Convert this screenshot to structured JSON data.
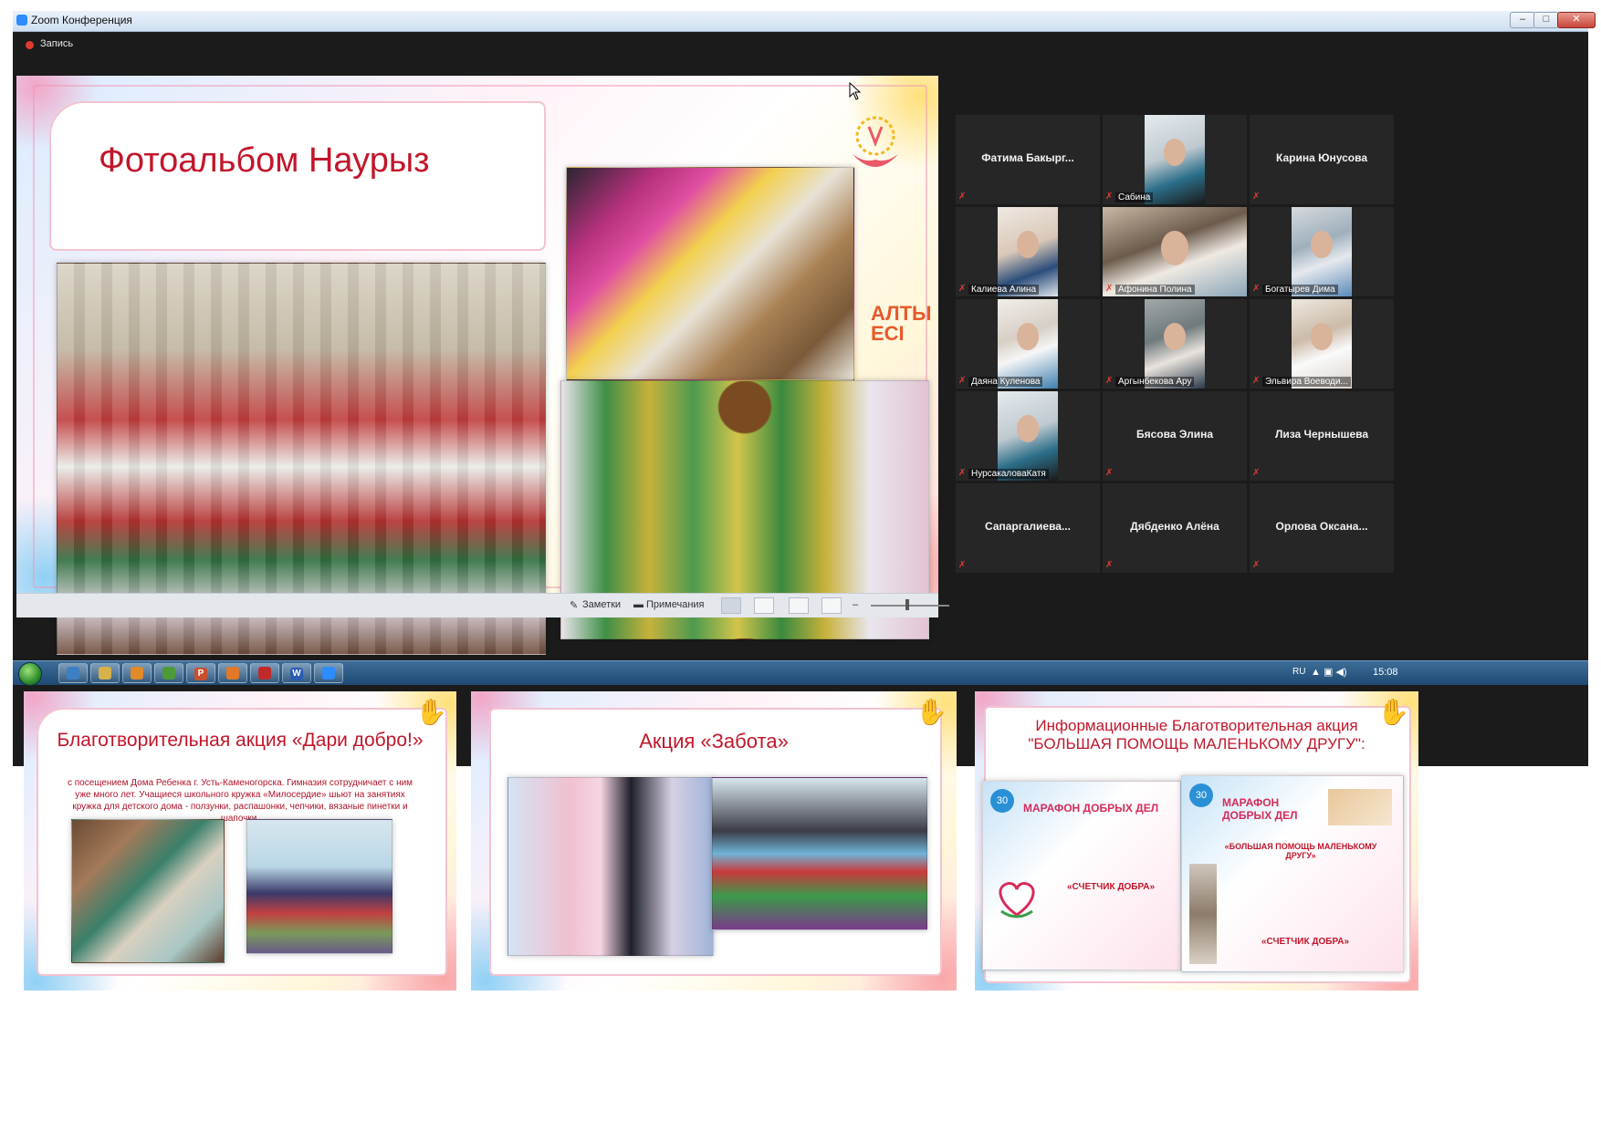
{
  "window": {
    "title": "Zoom Конференция",
    "recording_label": "Запись",
    "controls": {
      "minimize": "–",
      "maximize": "□",
      "close": "✕"
    }
  },
  "main_slide": {
    "title": "Фотоальбом Наурыз",
    "side_text": "АЛТЫ\nЕСІ"
  },
  "ppt_statusbar": {
    "notes_label": "Заметки",
    "comments_label": "Примечания"
  },
  "participants": [
    {
      "name": "Фатима Бакырг...",
      "video": false,
      "muted": true
    },
    {
      "name": "Сабина",
      "video": true,
      "muted": true
    },
    {
      "name": "Карина Юнусова",
      "video": false,
      "muted": true
    },
    {
      "name": "Калиева Алина",
      "video": true,
      "muted": true
    },
    {
      "name": "Афонина Полина",
      "video": true,
      "muted": true
    },
    {
      "name": "Богатырев Дима",
      "video": true,
      "muted": true
    },
    {
      "name": "Даяна Куленова",
      "video": true,
      "muted": true
    },
    {
      "name": "Аргынбекова Ару",
      "video": true,
      "muted": true
    },
    {
      "name": "Эльвира Воеводи...",
      "video": true,
      "muted": true
    },
    {
      "name": "НурсакаловаКатя",
      "video": true,
      "muted": true
    },
    {
      "name": "Бясова Элина",
      "video": false,
      "muted": true
    },
    {
      "name": "Лиза Чернышева",
      "video": false,
      "muted": true
    },
    {
      "name": "Сапаргалиева...",
      "video": false,
      "muted": true
    },
    {
      "name": "Дябденко Алёна",
      "video": false,
      "muted": true
    },
    {
      "name": "Орлова Оксана...",
      "video": false,
      "muted": true
    }
  ],
  "taskbar": {
    "language": "RU",
    "clock": "15:08",
    "apps": [
      "explorer-icon",
      "folder-icon",
      "media-icon",
      "chrome-icon",
      "P",
      "firefox-icon",
      "opera-icon",
      "W",
      "zoom-icon"
    ]
  },
  "bottom_slides": [
    {
      "title": "Благотворительная акция «Дари добро!»",
      "body": "с посещением Дома Ребенка г. Усть-Каменогорска. Гимназия сотрудничает с ним уже много лет. Учащиеся школьного кружка «Милосердие» шьют на занятиях кружка для детского дома - ползунки, распашонки, чепчики, вязаные пинетки и шапочки."
    },
    {
      "title": "Акция «Забота»"
    },
    {
      "title": "Информационные Благотворительная акция \"БОЛЬШАЯ ПОМОЩЬ МАЛЕНЬКОМУ ДРУГУ\":",
      "poster_left": {
        "heading": "МАРАФОН ДОБРЫХ ДЕЛ",
        "counter": "«СЧЕТЧИК ДОБРА»"
      },
      "poster_right": {
        "heading": "МАРАФОН ДОБРЫХ ДЕЛ",
        "subtitle": "«БОЛЬШАЯ ПОМОЩЬ МАЛЕНЬКОМУ ДРУГУ»",
        "counter": "«СЧЕТЧИК ДОБРА»"
      }
    }
  ],
  "colors": {
    "accent_red": "#c2162b",
    "zoom_blue": "#2d8cff",
    "muted_red": "#e03b2f",
    "tile_bg": "#262626"
  }
}
